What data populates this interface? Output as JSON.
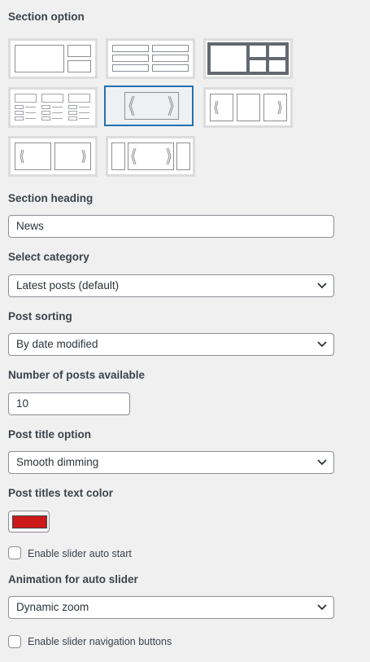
{
  "section_option": {
    "label": "Section option",
    "layouts": [
      {
        "name": "layout-one-large-two-small",
        "selected": false
      },
      {
        "name": "layout-two-column-list",
        "selected": false
      },
      {
        "name": "layout-grid-dark",
        "selected": false
      },
      {
        "name": "layout-three-column-list",
        "selected": false
      },
      {
        "name": "layout-single-slider",
        "selected": true
      },
      {
        "name": "layout-three-slide-slider",
        "selected": false
      },
      {
        "name": "layout-two-slide-slider",
        "selected": false
      },
      {
        "name": "layout-carousel-with-side-items",
        "selected": false
      }
    ]
  },
  "section_heading": {
    "label": "Section heading",
    "value": "News"
  },
  "select_category": {
    "label": "Select category",
    "value": "Latest posts (default)"
  },
  "post_sorting": {
    "label": "Post sorting",
    "value": "By date modified"
  },
  "posts_available": {
    "label": "Number of posts available",
    "value": "10"
  },
  "post_title_option": {
    "label": "Post title option",
    "value": "Smooth dimming"
  },
  "post_titles_color": {
    "label": "Post titles text color",
    "color": "#cc1a1a"
  },
  "slider_auto_start": {
    "label": "Enable slider auto start",
    "checked": false
  },
  "animation_auto_slider": {
    "label": "Animation for auto slider",
    "value": "Dynamic zoom"
  },
  "slider_nav_buttons": {
    "label": "Enable slider navigation buttons",
    "checked": false
  },
  "colors": {
    "accent": "#2271b1",
    "border": "#8c8f94",
    "background": "#f0f0f1"
  }
}
